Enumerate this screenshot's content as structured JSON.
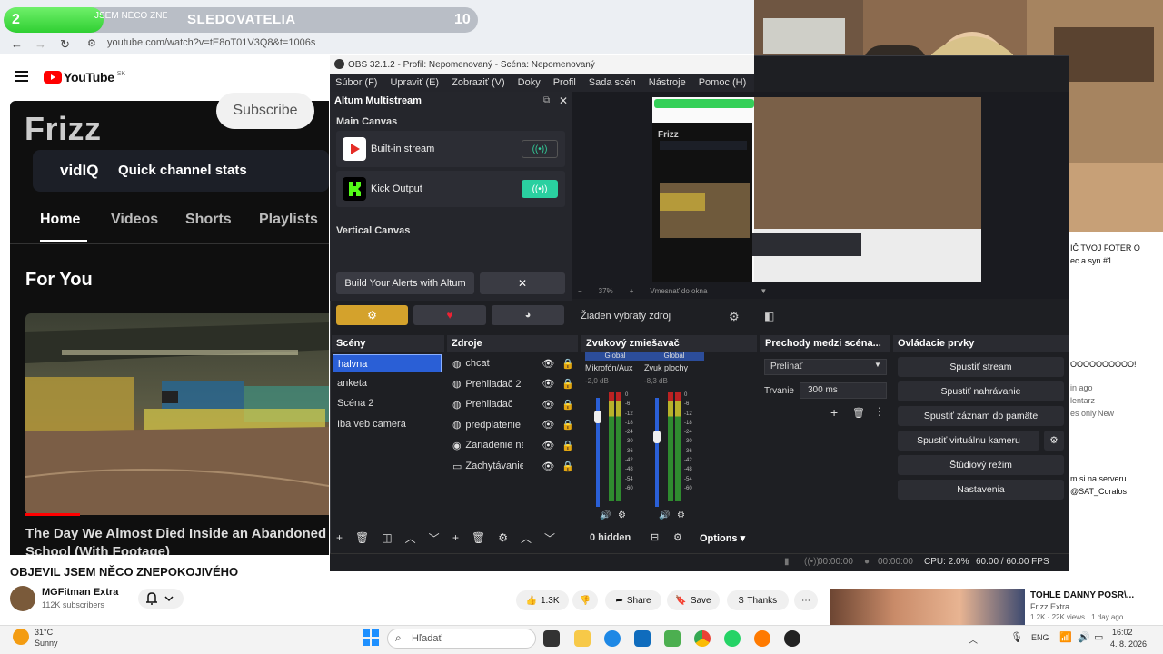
{
  "overlay": {
    "sub_goal_start": "2",
    "sub_goal_title": "SLEDOVATELIA",
    "sub_goal_end": "10",
    "sub_goal_progress_pct": 21,
    "tab_fragment": "JSEM NĚCO ZNEP"
  },
  "browser": {
    "url": "youtube.com/watch?v=tE8oT01V3Q8&t=1006s"
  },
  "youtube": {
    "logo": "YouTube",
    "logo_region": "SK",
    "channel_banner_name": "Frizz",
    "subscribe_label": "Subscribe",
    "vidiq_logo": "vidIQ",
    "vidiq_text": "Quick channel stats",
    "tabs": [
      "Home",
      "Videos",
      "Shorts",
      "Playlists"
    ],
    "section_title": "For You",
    "video_title": "The Day We Almost Died Inside an Abandoned School (With Footage)",
    "page_title": "OBJEVIL JSEM NĚCO ZNEPOKOJIVÉHO",
    "channel_owner": "MGFitman Extra",
    "channel_subs": "112K subscribers",
    "likes": "1.3K",
    "share": "Share",
    "save": "Save",
    "thanks": "Thanks",
    "rec_title": "TOHLE DANNY POSR\\...",
    "rec_channel": "Frizz Extra",
    "rec_meta": "1.2K · 22K views · 1 day ago"
  },
  "comments": [
    "IČ TVOJ FOTER O",
    "ec a syn #1",
    "OOOOOOOOOO!",
    "in ago",
    "lentarz",
    "es only",
    "New",
    "m si na serveru",
    "@SAT_Coralos"
  ],
  "obs": {
    "title": "OBS 32.1.2 - Profil: Nepomenovaný - Scéna: Nepomenovaný",
    "menu": [
      "Súbor (F)",
      "Upraviť (E)",
      "Zobraziť (V)",
      "Doky",
      "Profil",
      "Sada scén",
      "Nástroje",
      "Pomoc (H)"
    ],
    "altum_title": "Altum Multistream",
    "main_canvas": "Main Canvas",
    "outputs": [
      {
        "label": "Built-in stream"
      },
      {
        "label": "Kick Output"
      }
    ],
    "vertical_canvas": "Vertical Canvas",
    "alerts_button": "Build Your Alerts with Altum",
    "zoom": "37%",
    "zoom_mode": "Vmesnať do okna",
    "no_source": "Žiaden vybratý zdroj",
    "docks": {
      "scenes": "Scény",
      "sources": "Zdroje",
      "mixer": "Zvukový zmiešavač",
      "transitions": "Prechody medzi scéna...",
      "controls": "Ovládacie prvky"
    },
    "scenes": [
      "halvna",
      "anketa",
      "Scéna 2",
      "Iba veb camera"
    ],
    "sources": [
      "chcat",
      "Prehliadač 2",
      "Prehliadač",
      "predplatenie",
      "Zariadenie na zač",
      "Zachytávanie mo"
    ],
    "mixer": [
      {
        "tag": "Global",
        "name": "Mikrofón/Aux",
        "db": "-2,0 dB",
        "level": 0.88
      },
      {
        "tag": "Global",
        "name": "Zvuk plochy",
        "db": "-8,3 dB",
        "level": 0.7
      }
    ],
    "meter_scale": [
      "0",
      "-6",
      "-12",
      "-18",
      "-24",
      "-30",
      "-36",
      "-42",
      "-48",
      "-54",
      "-60"
    ],
    "mixer_hidden": "0 hidden",
    "mixer_options": "Options",
    "transition": "Prelínať",
    "duration_label": "Trvanie",
    "duration": "300 ms",
    "controls": [
      "Spustiť stream",
      "Spustiť nahrávanie",
      "Spustiť záznam do pamäte",
      "Spustiť virtuálnu kameru",
      "Štúdiový režim",
      "Nastavenia"
    ],
    "status": {
      "time1": "00:00:00",
      "time2": "00:00:00",
      "cpu": "CPU: 2.0%",
      "fps": "60.00 / 60.00 FPS"
    }
  },
  "taskbar": {
    "weather_temp": "31°C",
    "weather_desc": "Sunny",
    "search": "Hľadať",
    "lang": "ENG",
    "time": "16:02",
    "date": "4. 8. 2026"
  },
  "colors": {
    "accent_green": "#34d058",
    "obs_bg": "#1e1f23",
    "scene_active": "#2a5fd6",
    "kick_green": "#53fc18",
    "youtube_red": "#ff0000"
  }
}
